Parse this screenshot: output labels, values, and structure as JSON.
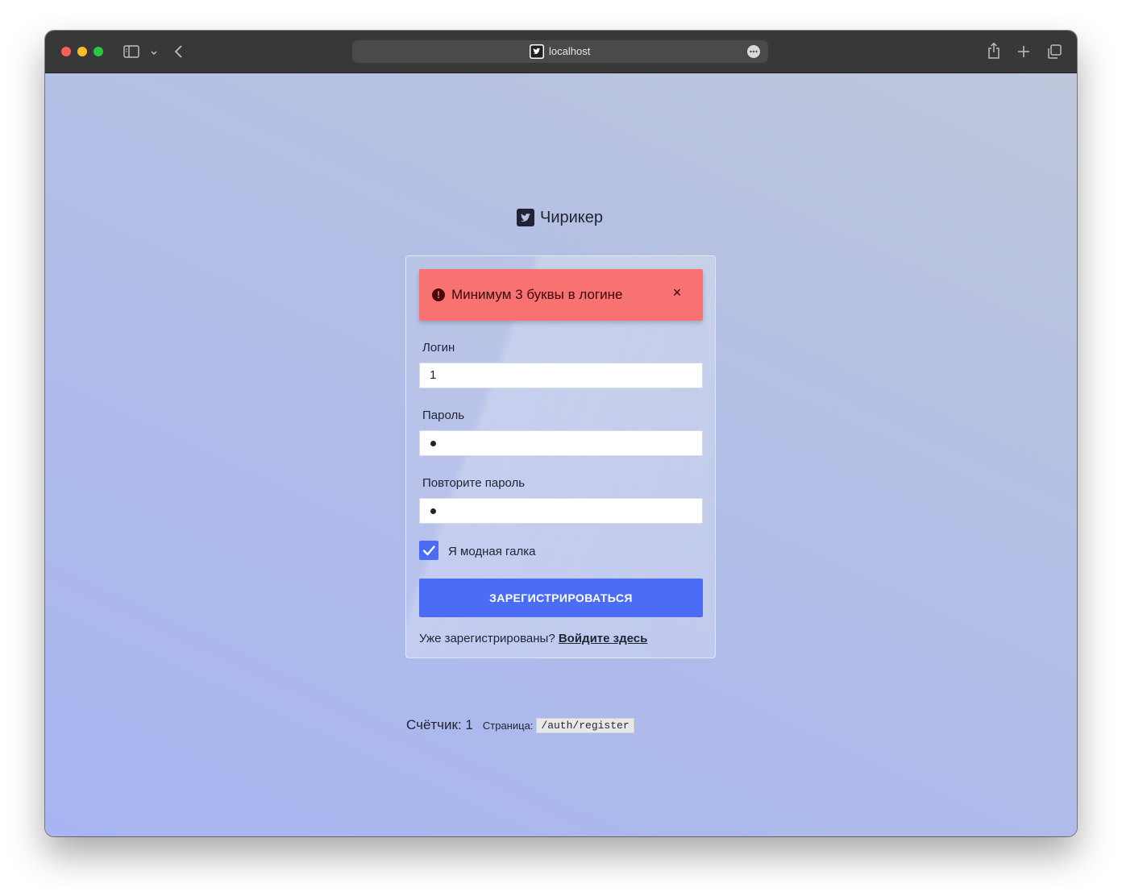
{
  "browser": {
    "address": "localhost"
  },
  "brand": {
    "name": "Чирикер",
    "icon": "twitter-icon"
  },
  "form": {
    "alert": {
      "message": "Минимум 3 буквы в логине",
      "close_symbol": "×"
    },
    "login_label": "Логин",
    "login_value": "1",
    "password_label": "Пароль",
    "password_repeat_label": "Повторите пароль",
    "checkbox_label": "Я модная галка",
    "checkbox_checked": true,
    "submit_label": "ЗАРЕГИСТРИРОВАТЬСЯ",
    "already_registered": "Уже зарегистрированы?",
    "login_link": "Войдите здесь"
  },
  "footer": {
    "counter": "Счётчик: 1",
    "page_label": "Страница:",
    "page_path": "/auth/register"
  },
  "colors": {
    "accent": "#4a6cf7",
    "alert": "#f87272"
  }
}
